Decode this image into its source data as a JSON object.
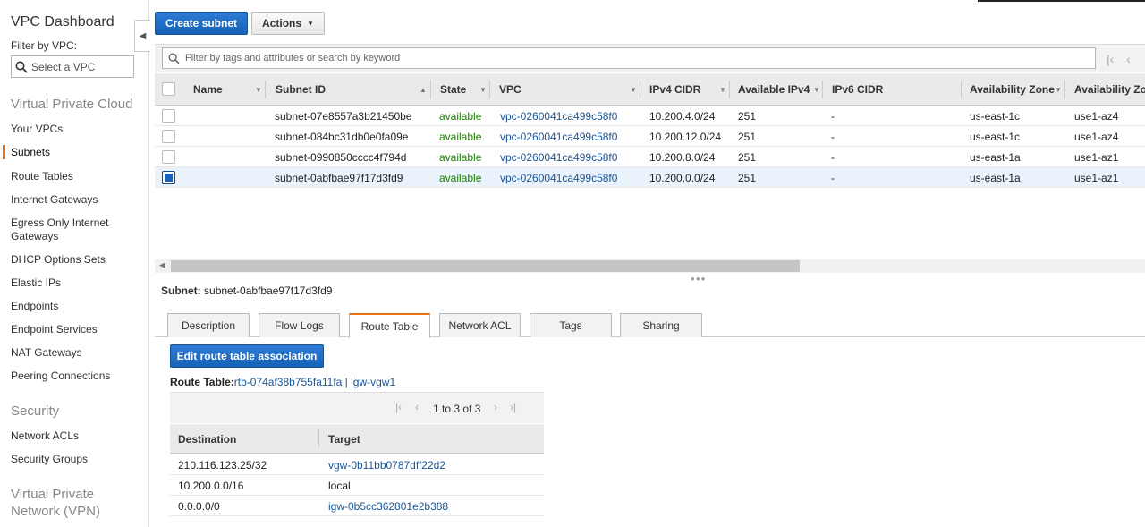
{
  "sidebar": {
    "title": "VPC Dashboard",
    "filter_label": "Filter by VPC:",
    "select_placeholder": "Select a VPC",
    "sections": {
      "vpc": "Virtual Private Cloud",
      "security": "Security",
      "vpn": "Virtual Private Network (VPN)"
    },
    "items": [
      "Your VPCs",
      "Subnets",
      "Route Tables",
      "Internet Gateways",
      "Egress Only Internet Gateways",
      "DHCP Options Sets",
      "Elastic IPs",
      "Endpoints",
      "Endpoint Services",
      "NAT Gateways",
      "Peering Connections"
    ],
    "security_items": [
      "Network ACLs",
      "Security Groups"
    ],
    "active_item": "Subnets",
    "active_color": "#ec7211"
  },
  "toolbar": {
    "create_label": "Create subnet",
    "actions_label": "Actions"
  },
  "search": {
    "placeholder": "Filter by tags and attributes or search by keyword"
  },
  "table": {
    "columns": [
      "Name",
      "Subnet ID",
      "State",
      "VPC",
      "IPv4 CIDR",
      "Available IPv4",
      "IPv6 CIDR",
      "Availability Zone",
      "Availability Zo"
    ],
    "rows": [
      {
        "name": "",
        "subnet_id": "subnet-07e8557a3b21450be",
        "state": "available",
        "vpc": "vpc-0260041ca499c58f0",
        "ipv4": "10.200.4.0/24",
        "avail": "251",
        "ipv6": "-",
        "az": "us-east-1c",
        "azid": "use1-az4",
        "selected": false
      },
      {
        "name": "",
        "subnet_id": "subnet-084bc31db0e0fa09e",
        "state": "available",
        "vpc": "vpc-0260041ca499c58f0",
        "ipv4": "10.200.12.0/24",
        "avail": "251",
        "ipv6": "-",
        "az": "us-east-1c",
        "azid": "use1-az4",
        "selected": false
      },
      {
        "name": "",
        "subnet_id": "subnet-0990850cccc4f794d",
        "state": "available",
        "vpc": "vpc-0260041ca499c58f0",
        "ipv4": "10.200.8.0/24",
        "avail": "251",
        "ipv6": "-",
        "az": "us-east-1a",
        "azid": "use1-az1",
        "selected": false
      },
      {
        "name": "",
        "subnet_id": "subnet-0abfbae97f17d3fd9",
        "state": "available",
        "vpc": "vpc-0260041ca499c58f0",
        "ipv4": "10.200.0.0/24",
        "avail": "251",
        "ipv6": "-",
        "az": "us-east-1a",
        "azid": "use1-az1",
        "selected": true
      }
    ]
  },
  "detail": {
    "subnet_label": "Subnet:",
    "subnet_value": "subnet-0abfbae97f17d3fd9",
    "tabs": [
      "Description",
      "Flow Logs",
      "Route Table",
      "Network ACL",
      "Tags",
      "Sharing"
    ],
    "active_tab": "Route Table",
    "edit_label": "Edit route table association",
    "route_table_label": "Route Table:",
    "route_table_value": "rtb-074af38b755fa11fa | igw-vgw1",
    "pager_text": "1 to 3 of 3",
    "route_headers": [
      "Destination",
      "Target"
    ],
    "routes": [
      {
        "destination": "210.116.123.25/32",
        "target": "vgw-0b11bb0787dff22d2",
        "link": true
      },
      {
        "destination": "10.200.0.0/16",
        "target": "local",
        "link": false
      },
      {
        "destination": "0.0.0.0/0",
        "target": "igw-0b5cc362801e2b388",
        "link": true
      }
    ]
  },
  "colors": {
    "primary_button": "#1562b6",
    "link": "#1a5494",
    "available": "#1d8102",
    "selected_row": "#eaf2fb"
  }
}
